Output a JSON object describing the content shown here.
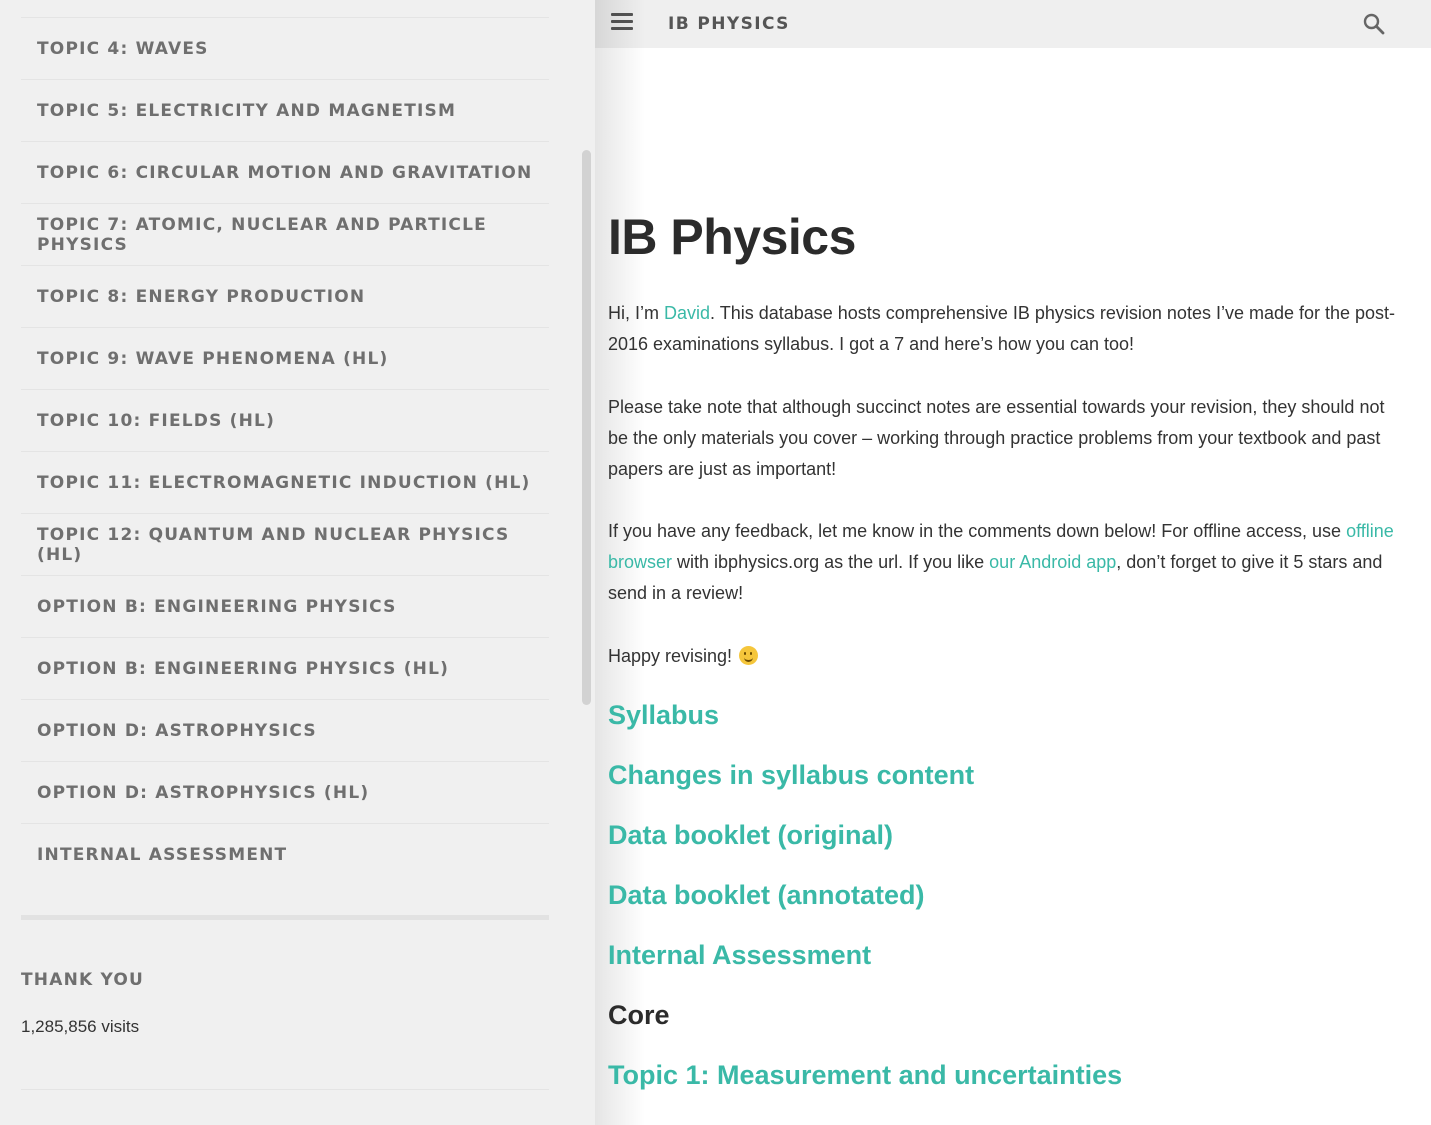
{
  "header": {
    "site_title": "IB PHYSICS"
  },
  "sidebar": {
    "items": [
      {
        "label": "TOPIC 4: WAVES"
      },
      {
        "label": "TOPIC 5: ELECTRICITY AND MAGNETISM"
      },
      {
        "label": "TOPIC 6: CIRCULAR MOTION AND GRAVITATION"
      },
      {
        "label": "TOPIC 7: ATOMIC, NUCLEAR AND PARTICLE PHYSICS"
      },
      {
        "label": "TOPIC 8: ENERGY PRODUCTION"
      },
      {
        "label": "TOPIC 9: WAVE PHENOMENA (HL)"
      },
      {
        "label": "TOPIC 10: FIELDS (HL)"
      },
      {
        "label": "TOPIC 11: ELECTROMAGNETIC INDUCTION (HL)"
      },
      {
        "label": "TOPIC 12: QUANTUM AND NUCLEAR PHYSICS (HL)"
      },
      {
        "label": "OPTION B: ENGINEERING PHYSICS"
      },
      {
        "label": "OPTION B: ENGINEERING PHYSICS (HL)"
      },
      {
        "label": "OPTION D: ASTROPHYSICS"
      },
      {
        "label": "OPTION D: ASTROPHYSICS (HL)"
      },
      {
        "label": "INTERNAL ASSESSMENT"
      }
    ],
    "widget": {
      "title": "THANK YOU",
      "visits": "1,285,856 visits"
    }
  },
  "main": {
    "title": "IB Physics",
    "intro": {
      "p1_before": "Hi, I’m ",
      "p1_link": "David",
      "p1_after": ". This database hosts comprehensive IB physics revision notes I’ve made for the post-2016 examinations syllabus. I got a 7 and here’s how you can too!",
      "p2": "Please take note that although succinct notes are essential towards your revision, they should not be the only materials you cover – working through practice problems from your textbook and past papers are just as important!",
      "p3_before": "If you have any feedback, let me know in the comments down below! For offline access, use ",
      "p3_link1": "offline browser",
      "p3_middle": " with ibphysics.org as the url. If you like ",
      "p3_link2": "our Android app",
      "p3_after": ", don’t forget to give it 5 stars and send in a review!",
      "p4": "Happy revising! "
    },
    "sections": {
      "syllabus": "Syllabus",
      "changes": "Changes in syllabus content",
      "data_original": "Data booklet (original)",
      "data_annotated": "Data booklet (annotated)",
      "internal_assessment": "Internal Assessment",
      "core": "Core",
      "topic1": "Topic 1: Measurement and uncertainties"
    }
  },
  "colors": {
    "accent": "#3ab9a7",
    "sidebar_bg": "#f0f0f0",
    "nav_text": "#6f6f6f"
  },
  "icons": {
    "menu": "hamburger-menu-icon",
    "search": "search-icon",
    "emoji": "slightly-smiling-face-icon"
  }
}
